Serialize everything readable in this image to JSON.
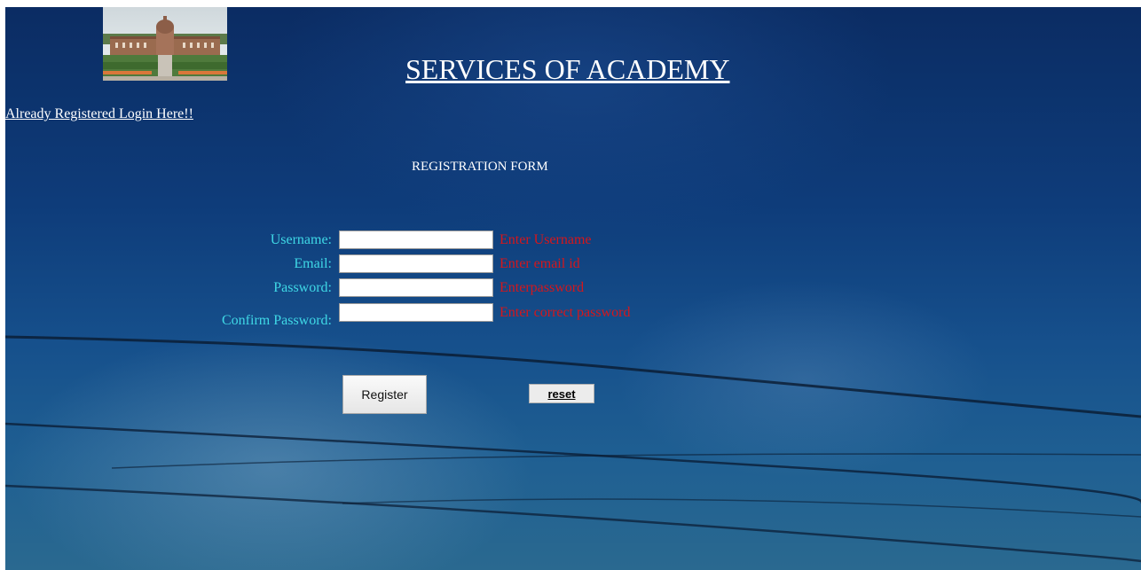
{
  "header": {
    "title": "SERVICES OF ACADEMY",
    "logo_icon": "academy-building-photo"
  },
  "nav": {
    "login_link": "Already Registered Login Here!!"
  },
  "form": {
    "heading": "REGISTRATION FORM",
    "fields": [
      {
        "label": "Username:",
        "value": "",
        "hint": "Enter Username"
      },
      {
        "label": "Email:",
        "value": "",
        "hint": "Enter email id"
      },
      {
        "label": "Password:",
        "value": "",
        "hint": "Enterpassword"
      },
      {
        "label": "Confirm Password:",
        "value": "",
        "hint": "Enter correct password"
      }
    ],
    "register_label": "Register",
    "reset_label": "reset"
  },
  "colors": {
    "label": "#3fd8e6",
    "hint": "#d6161b",
    "background": "#0e3c7a"
  }
}
